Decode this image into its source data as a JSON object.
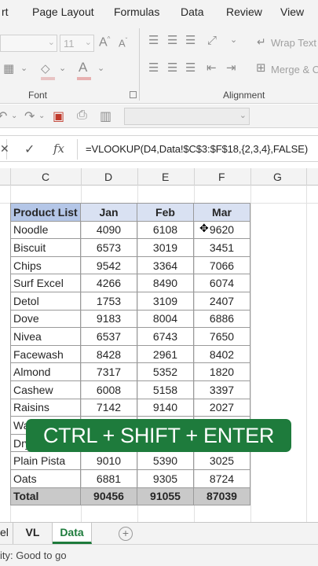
{
  "ribbon": {
    "tabs": [
      "rt",
      "Page Layout",
      "Formulas",
      "Data",
      "Review",
      "View"
    ],
    "font_size_value": "11",
    "wrap_text_label": "Wrap Text",
    "merge_label": "Merge & C",
    "font_group_label": "Font",
    "alignment_group_label": "Alignment",
    "font_color_letter": "A",
    "fill_color_letter": "A"
  },
  "formula_bar": {
    "cancel_glyph": "✕",
    "enter_glyph": "✓",
    "fx_label": "fx",
    "formula": "=VLOOKUP(D4,Data!$C$3:$F$18,{2,3,4},FALSE)"
  },
  "grid": {
    "columns": [
      "C",
      "D",
      "E",
      "F",
      "G"
    ],
    "headers": [
      "Product List",
      "Jan",
      "Feb",
      "Mar"
    ],
    "rows": [
      [
        "Noodle",
        "4090",
        "6108",
        "9620"
      ],
      [
        "Biscuit",
        "6573",
        "3019",
        "3451"
      ],
      [
        "Chips",
        "9542",
        "3364",
        "7066"
      ],
      [
        "Surf Excel",
        "4266",
        "8490",
        "6074"
      ],
      [
        "Detol",
        "1753",
        "3109",
        "2407"
      ],
      [
        "Dove",
        "9183",
        "8004",
        "6886"
      ],
      [
        "Nivea",
        "6537",
        "6743",
        "7650"
      ],
      [
        "Facewash",
        "8428",
        "2961",
        "8402"
      ],
      [
        "Almond",
        "7317",
        "5352",
        "1820"
      ],
      [
        "Cashew",
        "6008",
        "5158",
        "3397"
      ],
      [
        "Raisins",
        "7142",
        "9140",
        "2027"
      ],
      [
        "Wa",
        "",
        "",
        ""
      ],
      [
        "Dry",
        "",
        "",
        ""
      ],
      [
        "Plain Pista",
        "9010",
        "5390",
        "3025"
      ],
      [
        "Oats",
        "6881",
        "9305",
        "8724"
      ]
    ],
    "total": [
      "Total",
      "90456",
      "91055",
      "87039"
    ]
  },
  "overlay_text": "CTRL + SHIFT + ENTER",
  "sheets": {
    "tabs": [
      "el",
      "VL",
      "Data"
    ],
    "active": "Data",
    "add_glyph": "+"
  },
  "status": {
    "text": "ity: Good to go"
  },
  "colors": {
    "accent": "#1e7b3c",
    "header_fill": "#d9e1f2",
    "product_header_fill": "#b4c6e7",
    "total_fill": "#c9c9c9"
  }
}
